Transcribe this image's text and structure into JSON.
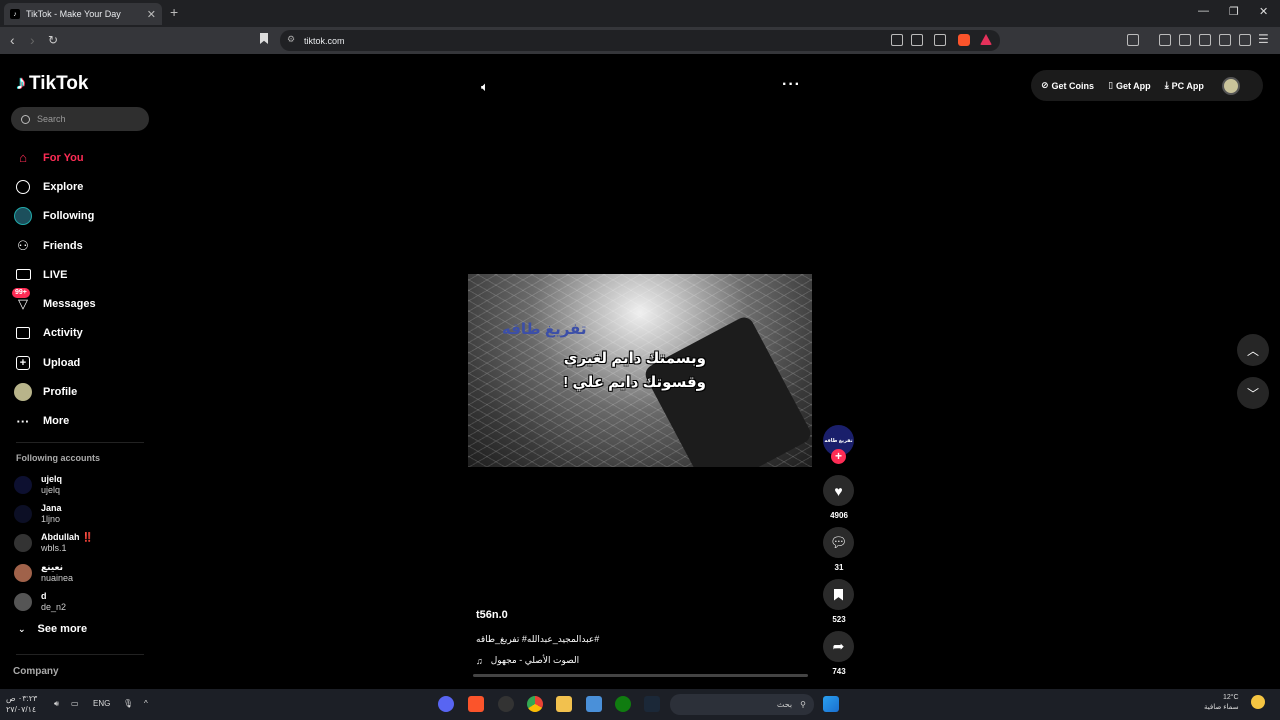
{
  "browser": {
    "tab_title": "TikTok - Make Your Day",
    "url": "tiktok.com",
    "new_tab": "+",
    "close_tab": "✕"
  },
  "sidebar": {
    "logo_text": "TikTok",
    "search_placeholder": "Search",
    "items": [
      {
        "label": "For You",
        "icon": "home-icon"
      },
      {
        "label": "Explore",
        "icon": "compass-icon"
      },
      {
        "label": "Following",
        "icon": "following-avatar-icon"
      },
      {
        "label": "Friends",
        "icon": "friends-icon"
      },
      {
        "label": "LIVE",
        "icon": "live-tv-icon"
      },
      {
        "label": "Messages",
        "icon": "messages-icon",
        "badge": "99+"
      },
      {
        "label": "Activity",
        "icon": "activity-icon"
      },
      {
        "label": "Upload",
        "icon": "upload-icon"
      },
      {
        "label": "Profile",
        "icon": "profile-avatar-icon"
      },
      {
        "label": "More",
        "icon": "more-dots-icon"
      }
    ],
    "following_title": "Following accounts",
    "accounts": [
      {
        "name": "ujelq",
        "handle": "ujelq"
      },
      {
        "name": "Jana",
        "handle": "1ljno"
      },
      {
        "name": "Abdullah ‼️",
        "handle": "wbls.1"
      },
      {
        "name": "نعينع",
        "handle": "nuainea"
      },
      {
        "name": "d",
        "handle": "de_n2"
      }
    ],
    "see_more": "See more",
    "company": "Company"
  },
  "video": {
    "watermark": "تفريغ طاقه",
    "caption_line1": "وبسمتك دايم لغيري",
    "caption_line2": "وقسوتك دايم علي !",
    "author": "t56n.0",
    "hashtags": "#عبدالمجيد_عبدالله# تفريغ_طاقه",
    "music": "الصوت الأصلي - مجهول",
    "creator_avatar_text": "تفريغ طاقه"
  },
  "actions": {
    "likes": "4906",
    "comments": "31",
    "saves": "523",
    "shares": "743"
  },
  "topright": {
    "get_coins": "Get Coins",
    "get_app": "Get App",
    "pc_app": "PC App"
  },
  "taskbar": {
    "time": "٠٣:٢٣ ص",
    "date": "٢٧/٠٧/١٤",
    "language": "ENG",
    "search_placeholder": "بحث",
    "weather_temp": "12°C",
    "weather_desc": "سماء صافية"
  },
  "colors": {
    "accent": "#fe2c55",
    "background": "#000000",
    "sidebar_search_bg": "#2f2f2f"
  }
}
